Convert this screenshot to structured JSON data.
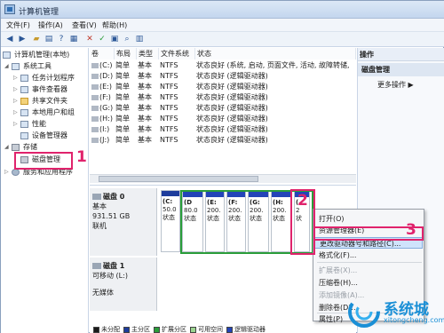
{
  "window": {
    "title": "计算机管理"
  },
  "menu": [
    "文件(F)",
    "操作(A)",
    "查看(V)",
    "帮助(H)"
  ],
  "toolbar": {
    "buttons": [
      "back-icon",
      "forward-icon",
      "folder-up-icon",
      "list-view-icon",
      "help-icon",
      "properties-icon",
      "close-icon",
      "check-icon",
      "open-icon",
      "search-icon",
      "view-icon"
    ]
  },
  "tree": {
    "root": "计算机管理(本地)",
    "system_tools": "系统工具",
    "task_scheduler": "任务计划程序",
    "event_viewer": "事件查看器",
    "shared_folders": "共享文件夹",
    "local_users": "本地用户和组",
    "performance": "性能",
    "device_manager": "设备管理器",
    "storage": "存储",
    "disk_management": "磁盘管理",
    "services": "服务和应用程序"
  },
  "volumes": {
    "headers": [
      "卷",
      "布局",
      "类型",
      "文件系统",
      "状态"
    ],
    "rows": [
      [
        "(C:)",
        "简单",
        "基本",
        "NTFS",
        "状态良好 (系统, 启动, 页面文件, 活动, 故障转储,"
      ],
      [
        "(D:)",
        "简单",
        "基本",
        "NTFS",
        "状态良好 (逻辑驱动器)"
      ],
      [
        "(E:)",
        "简单",
        "基本",
        "NTFS",
        "状态良好 (逻辑驱动器)"
      ],
      [
        "(F:)",
        "简单",
        "基本",
        "NTFS",
        "状态良好 (逻辑驱动器)"
      ],
      [
        "(G:)",
        "简单",
        "基本",
        "NTFS",
        "状态良好 (逻辑驱动器)"
      ],
      [
        "(H:)",
        "简单",
        "基本",
        "NTFS",
        "状态良好 (逻辑驱动器)"
      ],
      [
        "(I:)",
        "简单",
        "基本",
        "NTFS",
        "状态良好 (逻辑驱动器)"
      ],
      [
        "(J:)",
        "简单",
        "基本",
        "NTFS",
        "状态良好 (逻辑驱动器)"
      ]
    ]
  },
  "disk0": {
    "name": "磁盘 0",
    "type": "基本",
    "size": "931.51 GB",
    "status": "联机",
    "partitions": [
      {
        "label": "(C:",
        "size": "50.0",
        "status": "状态"
      },
      {
        "label": "(D",
        "size": "80.0",
        "status": "状态"
      },
      {
        "label": "(E:",
        "size": "200.",
        "status": "状态"
      },
      {
        "label": "(F:",
        "size": "200.",
        "status": "状态"
      },
      {
        "label": "(G:",
        "size": "200.",
        "status": "状态"
      },
      {
        "label": "(H:",
        "size": "200.",
        "status": "状态"
      },
      {
        "label": "(",
        "size": "2",
        "status": "状"
      }
    ]
  },
  "disk1": {
    "name": "磁盘 1",
    "type": "可移动 (L:)",
    "media": "无媒体"
  },
  "legend": [
    {
      "label": "未分配",
      "color": "#1a1a1a"
    },
    {
      "label": "主分区",
      "color": "#1d3c9c"
    },
    {
      "label": "扩展分区",
      "color": "#2a9d3a"
    },
    {
      "label": "可用空间",
      "color": "#9bd48f"
    },
    {
      "label": "逻辑驱动器",
      "color": "#2344b8"
    }
  ],
  "actions": {
    "title": "操作",
    "section": "磁盘管理",
    "more": "更多操作"
  },
  "context_menu": {
    "items": [
      {
        "label": "打开(O)",
        "enabled": true
      },
      {
        "label": "资源管理器(E)",
        "enabled": true
      },
      {
        "label": "更改驱动器号和路径(C)...",
        "enabled": true,
        "highlighted": true
      },
      {
        "label": "格式化(F)...",
        "enabled": true
      },
      {
        "label": "扩展卷(X)...",
        "enabled": false
      },
      {
        "label": "压缩卷(H)...",
        "enabled": true
      },
      {
        "label": "添加镜像(A)...",
        "enabled": false
      },
      {
        "label": "删除卷(D)...",
        "enabled": true
      },
      {
        "label": "属性(P)",
        "enabled": true
      }
    ]
  },
  "callouts": [
    "1",
    "2",
    "3"
  ],
  "watermark": {
    "text": "系统城",
    "url": "xitongcheng.com"
  }
}
